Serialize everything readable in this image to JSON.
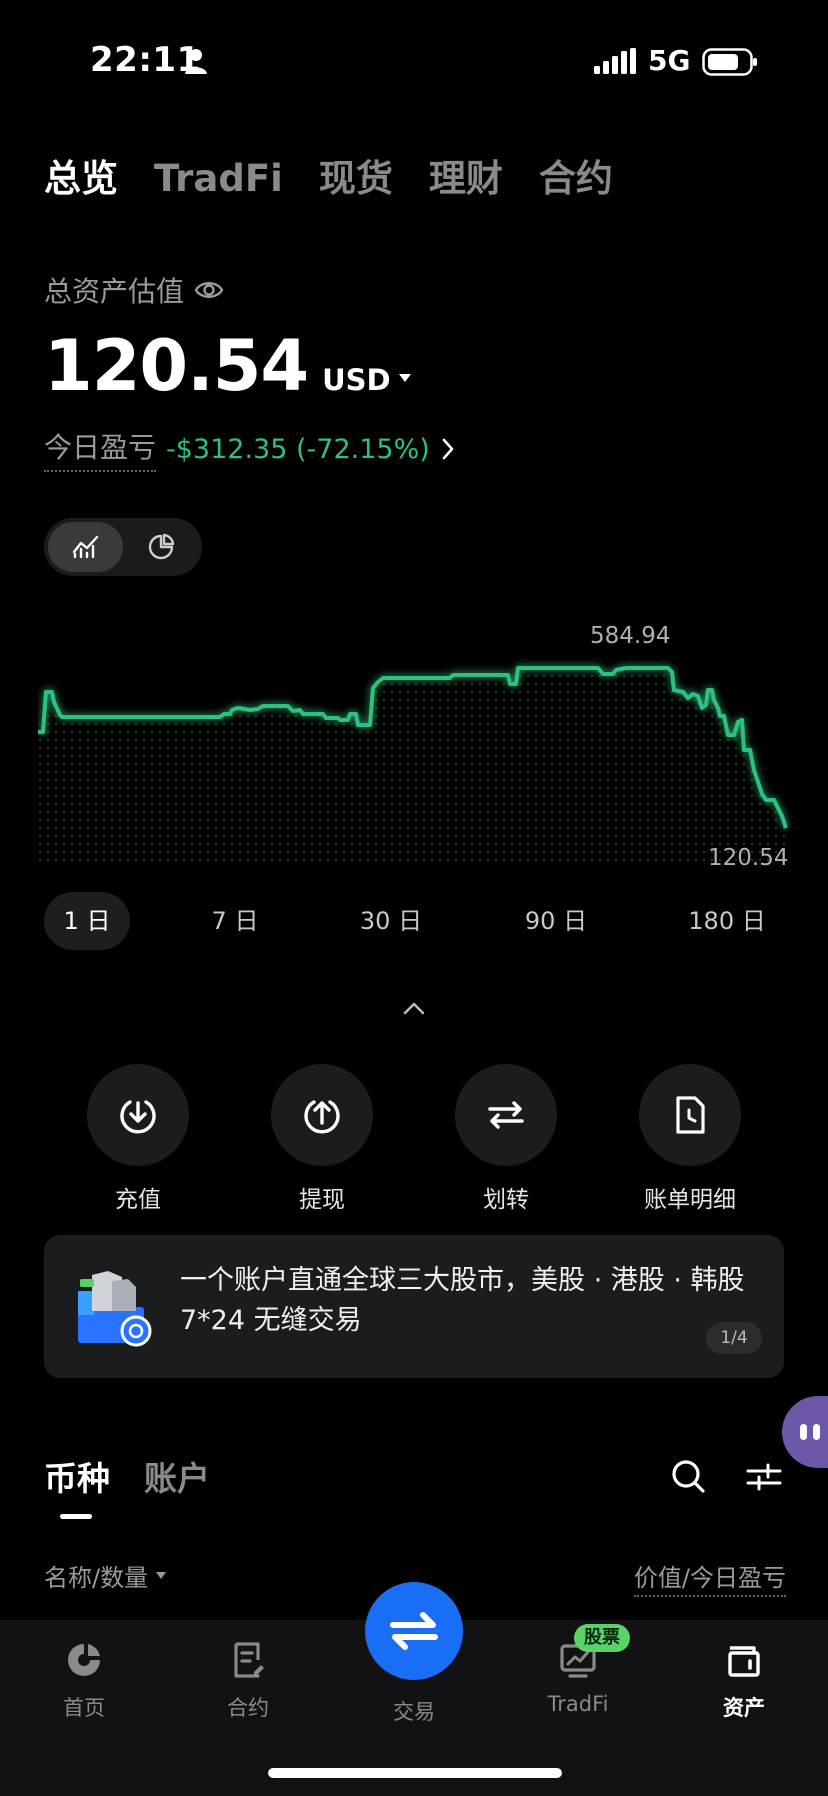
{
  "status_bar": {
    "time": "22:11",
    "network": "5G"
  },
  "top_tabs": [
    "总览",
    "TradFi",
    "现货",
    "理财",
    "合约"
  ],
  "summary": {
    "label": "总资产估值",
    "balance": "120.54",
    "currency": "USD",
    "pnl_label": "今日盈亏",
    "pnl_value": "-$312.35 (-72.15%)",
    "accent_color": "#2ec07f"
  },
  "chart": {
    "max_label": "584.94",
    "min_label": "120.54",
    "line_color": "#2ec07f"
  },
  "range_tabs": [
    "1 日",
    "7 日",
    "30 日",
    "90 日",
    "180 日"
  ],
  "actions": [
    {
      "label": "充值",
      "icon": "deposit-icon"
    },
    {
      "label": "提现",
      "icon": "withdraw-icon"
    },
    {
      "label": "划转",
      "icon": "transfer-icon"
    },
    {
      "label": "账单明细",
      "icon": "bill-icon"
    }
  ],
  "banner": {
    "text": "一个账户直通全球三大股市，美股 · 港股 · 韩股 7*24 无缝交易",
    "page": "1/4"
  },
  "list_tabs": [
    "币种",
    "账户"
  ],
  "list_header": {
    "left": "名称/数量",
    "right": "价值/今日盈亏"
  },
  "bottom_nav": {
    "home": "首页",
    "contract": "合约",
    "trade": "交易",
    "tradfi": "TradFi",
    "assets": "资产",
    "stock_badge": "股票",
    "brand_blue": "#1a6df5"
  }
}
